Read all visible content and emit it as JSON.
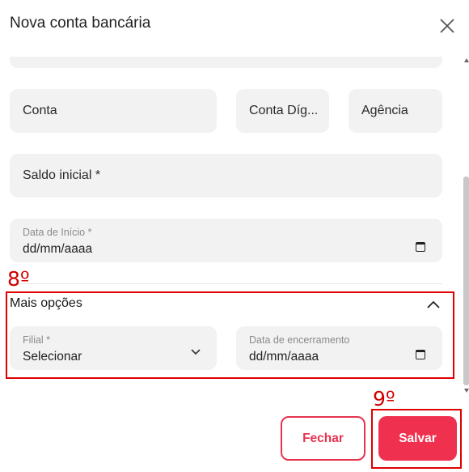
{
  "dialog": {
    "title": "Nova conta bancária"
  },
  "fields": {
    "conta": {
      "placeholder": "Conta"
    },
    "conta_digito": {
      "placeholder": "Conta Díg..."
    },
    "agencia": {
      "placeholder": "Agência"
    },
    "saldo_inicial": {
      "placeholder": "Saldo inicial *"
    },
    "data_inicio": {
      "label": "Data de Início *",
      "value": "dd/mm/aaaa"
    }
  },
  "mais_opcoes": {
    "title": "Mais opções",
    "filial": {
      "label": "Filial *",
      "value": "Selecionar"
    },
    "data_encerramento": {
      "label": "Data de encerramento",
      "value": "dd/mm/aaaa"
    }
  },
  "annotations": {
    "step8": "8º",
    "step9": "9º"
  },
  "footer": {
    "fechar_label": "Fechar",
    "salvar_label": "Salvar"
  },
  "colors": {
    "accent": "#f0304f",
    "annotation": "#e00000",
    "field_bg": "#f2f2f2"
  }
}
